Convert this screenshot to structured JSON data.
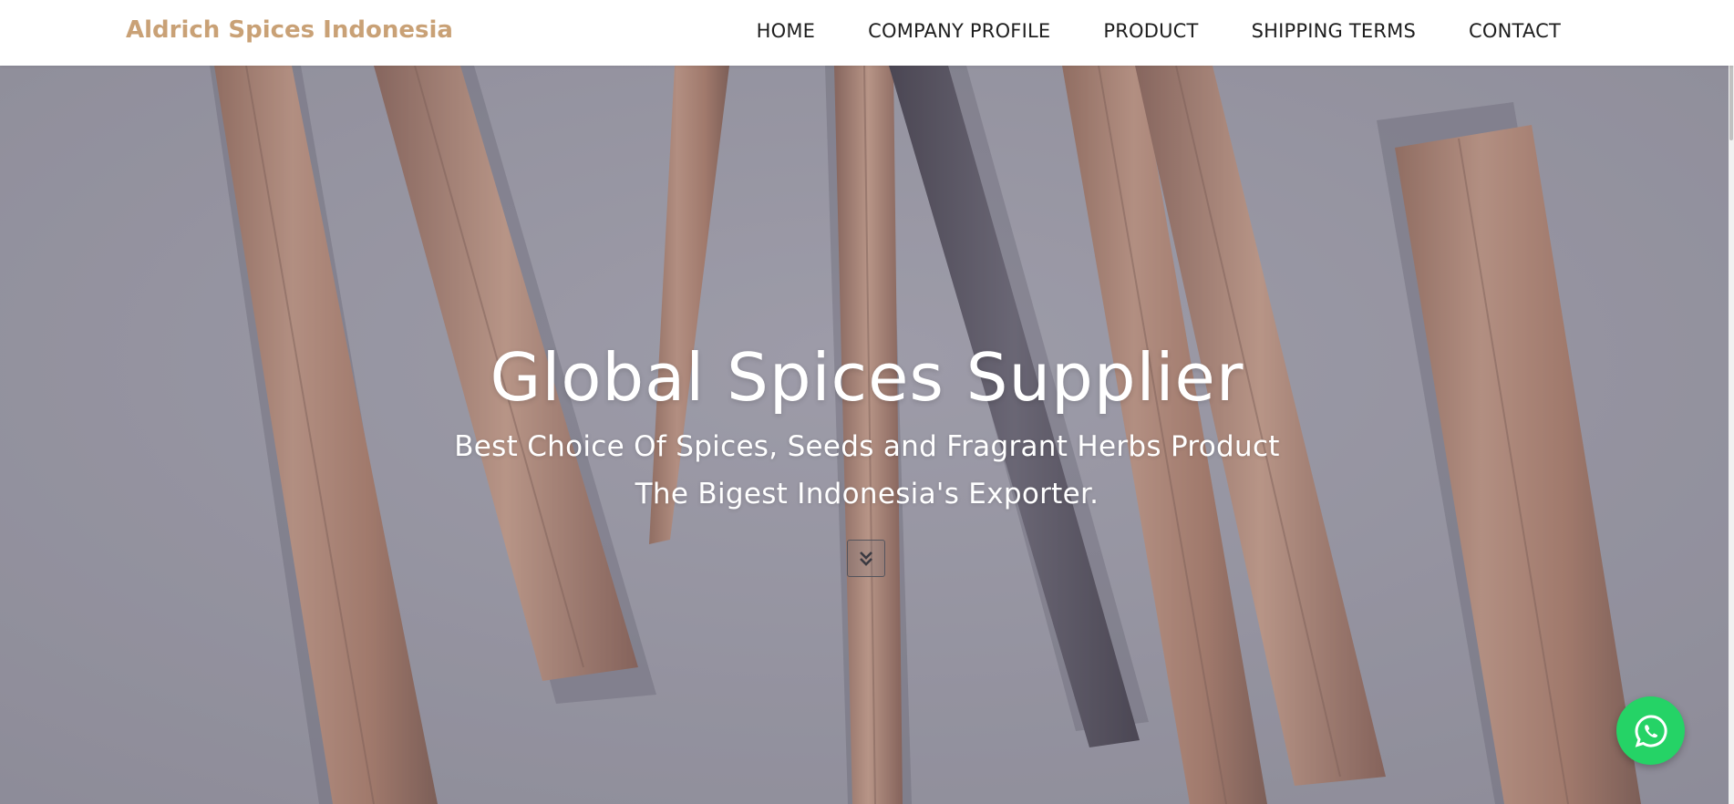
{
  "brand": {
    "name": "Aldrich Spices Indonesia",
    "color": "#c9a176"
  },
  "nav": {
    "items": [
      {
        "label": "HOME"
      },
      {
        "label": "COMPANY PROFILE"
      },
      {
        "label": "PRODUCT"
      },
      {
        "label": "SHIPPING TERMS"
      },
      {
        "label": "CONTACT"
      }
    ]
  },
  "hero": {
    "title": "Global Spices Supplier",
    "subtitle_line1": "Best Choice Of Spices, Seeds and Fragrant Herbs Product",
    "subtitle_line2": "The Bigest Indonesia's Exporter.",
    "scroll_icon": "chevron-double-down-icon"
  },
  "floating": {
    "icon": "whatsapp-icon",
    "color": "#25d366"
  }
}
